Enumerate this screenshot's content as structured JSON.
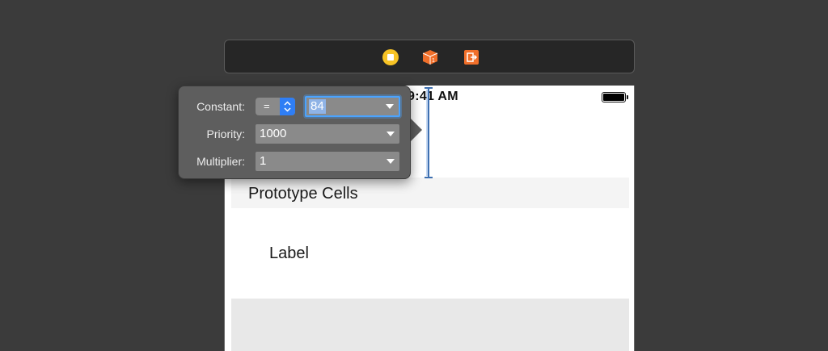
{
  "scene_dock": {
    "icons": [
      "view-controller-icon",
      "first-responder-icon",
      "exit-icon"
    ],
    "colors": {
      "view_controller": "#f7c325",
      "first_responder": "#f06f2a",
      "exit": "#f06f2a"
    }
  },
  "status_bar": {
    "time": "9:41 AM"
  },
  "table": {
    "section_header": "Prototype Cells",
    "cell_label": "Label"
  },
  "constraint_popover": {
    "constant": {
      "label": "Constant:",
      "relation": "=",
      "value": "84"
    },
    "priority": {
      "label": "Priority:",
      "value": "1000"
    },
    "multiplier": {
      "label": "Multiplier:",
      "value": "1"
    }
  },
  "colors": {
    "selection_ring": "#4aa3ff",
    "stepper": "#2f7ef5",
    "constraint_line": "#3d6fb0"
  }
}
